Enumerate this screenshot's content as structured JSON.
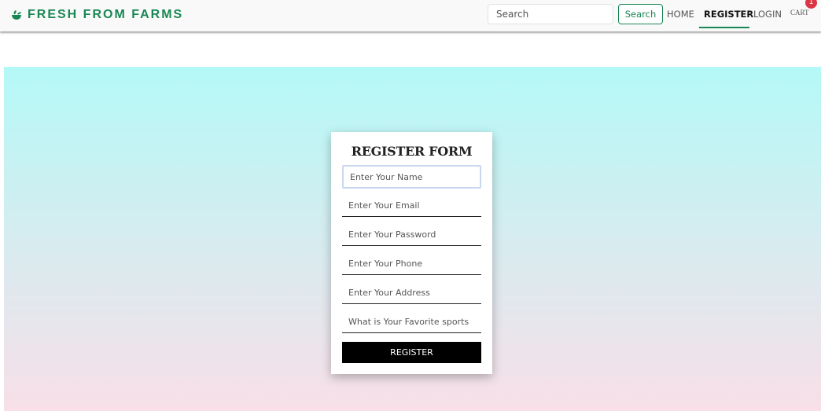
{
  "colors": {
    "brand": "#198754",
    "hero_top": "#b4f9f7",
    "hero_bottom": "#f8dfe8",
    "badge": "#dc3545",
    "register_button_bg": "#000000",
    "register_button_text": "#ffffff"
  },
  "brand": {
    "icon": "mortar-leaf-icon",
    "name": "FRESH FROM FARMS"
  },
  "search": {
    "placeholder": "Search",
    "button_label": "Search"
  },
  "nav": {
    "home": "HOME",
    "register": "REGISTER",
    "login": "LOGIN",
    "cart": "CART",
    "cart_count": "1",
    "active": "REGISTER"
  },
  "form": {
    "title": "REGISTER FORM",
    "fields": {
      "name": "Enter Your Name",
      "email": "Enter Your Email",
      "password": "Enter Your Password",
      "phone": "Enter Your Phone",
      "address": "Enter Your Address",
      "sports": "What is Your Favorite sports"
    },
    "submit_label": "REGISTER"
  }
}
